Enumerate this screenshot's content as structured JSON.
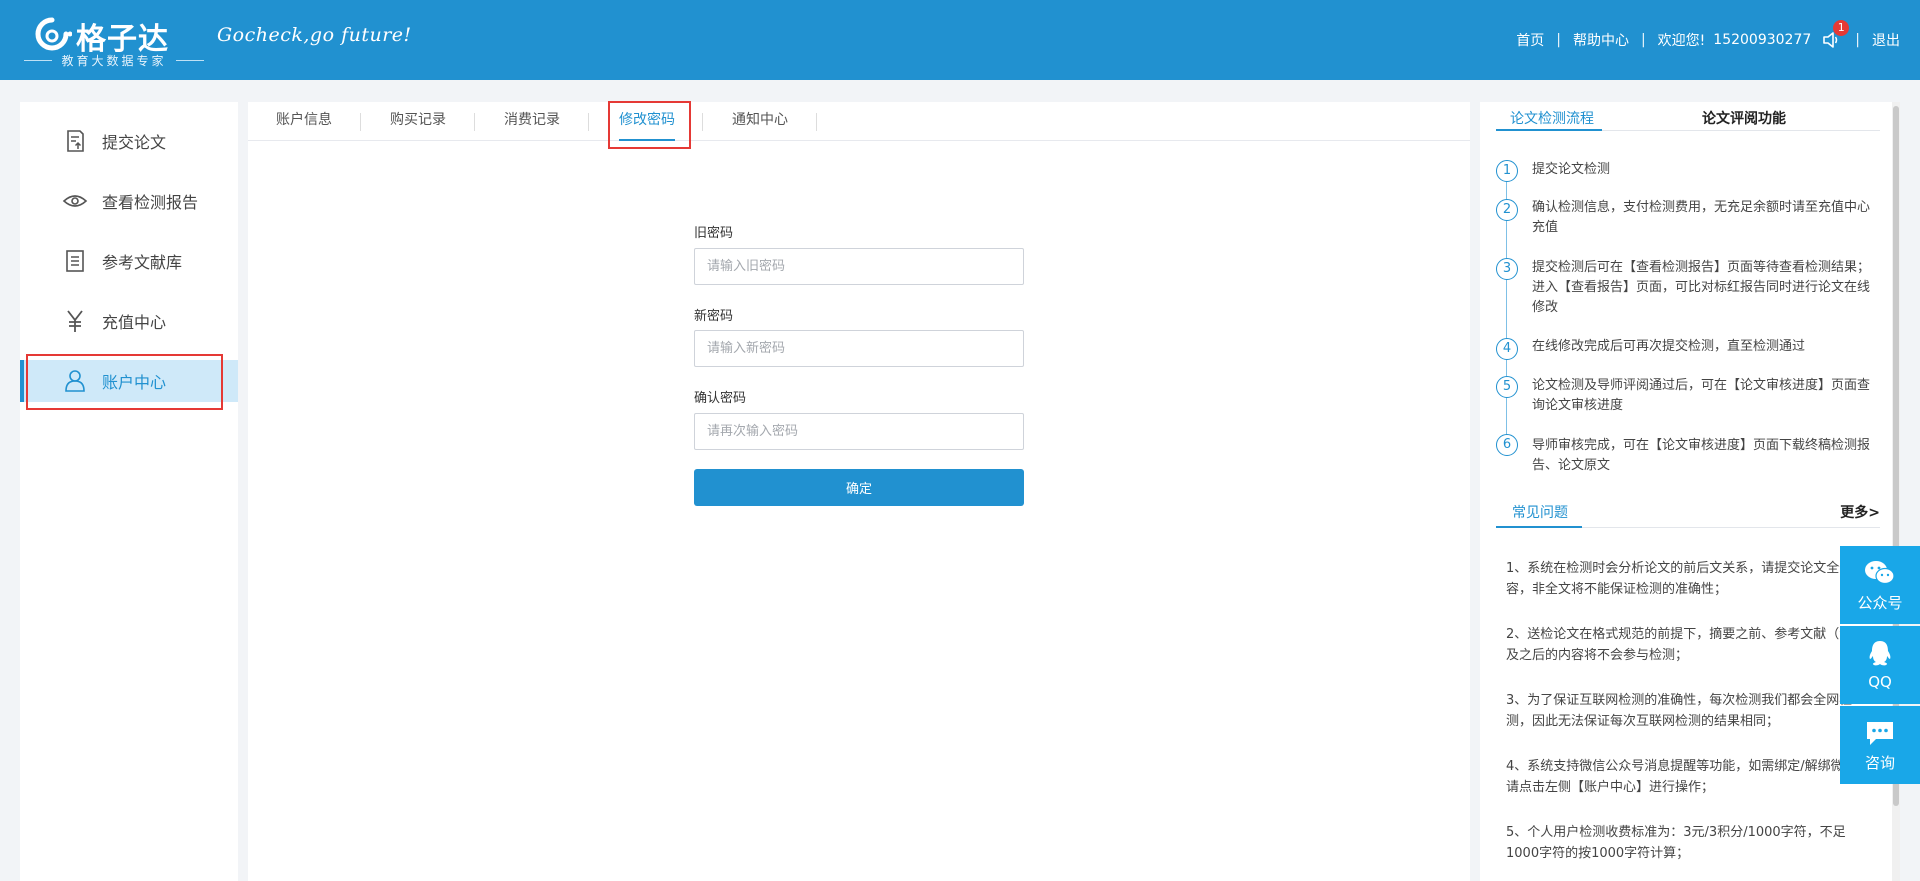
{
  "colors": {
    "primary": "#2191d0",
    "highlight_box": "#e53935",
    "float_button": "#19a7e8"
  },
  "header": {
    "logo_text": "格子达",
    "logo_sub": "教育大数据专家",
    "slogan": "Gocheck,go future!",
    "nav": {
      "home": "首页",
      "help": "帮助中心",
      "welcome": "欢迎您!",
      "user": "15200930277",
      "notification_count": "1",
      "logout": "退出"
    }
  },
  "sidebar": {
    "items": [
      {
        "label": "提交论文",
        "icon": "document-upload-icon"
      },
      {
        "label": "查看检测报告",
        "icon": "eye-icon"
      },
      {
        "label": "参考文献库",
        "icon": "book-list-icon"
      },
      {
        "label": "充值中心",
        "icon": "yen-icon"
      },
      {
        "label": "账户中心",
        "icon": "user-icon",
        "active": true
      }
    ]
  },
  "tabs": [
    {
      "label": "账户信息"
    },
    {
      "label": "购买记录"
    },
    {
      "label": "消费记录"
    },
    {
      "label": "修改密码",
      "active": true
    },
    {
      "label": "通知中心"
    }
  ],
  "form": {
    "old_label": "旧密码",
    "old_placeholder": "请输入旧密码",
    "new_label": "新密码",
    "new_placeholder": "请输入新密码",
    "confirm_label": "确认密码",
    "confirm_placeholder": "请再次输入密码",
    "submit": "确定"
  },
  "right": {
    "tab_flow": "论文检测流程",
    "tab_review": "论文评阅功能",
    "steps": [
      {
        "num": "1",
        "text": "提交论文检测"
      },
      {
        "num": "2",
        "text": "确认检测信息，支付检测费用，无充足余额时请至充值中心充值"
      },
      {
        "num": "3",
        "text": "提交检测后可在【查看检测报告】页面等待查看检测结果；进入【查看报告】页面，可比对标红报告同时进行论文在线修改"
      },
      {
        "num": "4",
        "text": "在线修改完成后可再次提交检测，直至检测通过"
      },
      {
        "num": "5",
        "text": "论文检测及导师评阅通过后，可在【论文审核进度】页面查询论文审核进度"
      },
      {
        "num": "6",
        "text": "导师审核完成，可在【论文审核进度】页面下载终稿检测报告、论文原文"
      }
    ],
    "faq_title": "常见问题",
    "faq_more": "更多>",
    "faq": [
      "1、系统在检测时会分析论文的前后文关系，请提交论文全部内容，非全文将不能保证检测的准确性；",
      "2、送检论文在格式规范的前提下，摘要之前、参考文献（含）及之后的内容将不会参与检测；",
      "3、为了保证互联网检测的准确性，每次检测我们都会全网检测，因此无法保证每次互联网检测的结果相同；",
      "4、系统支持微信公众号消息提醒等功能，如需绑定/解绑微信，请点击左侧【账户中心】进行操作；",
      "5、个人用户检测收费标准为：3元/3积分/1000字符，不足1000字符的按1000字符计算；"
    ]
  },
  "float": {
    "wechat": "公众号",
    "qq": "QQ",
    "consult": "咨询"
  }
}
